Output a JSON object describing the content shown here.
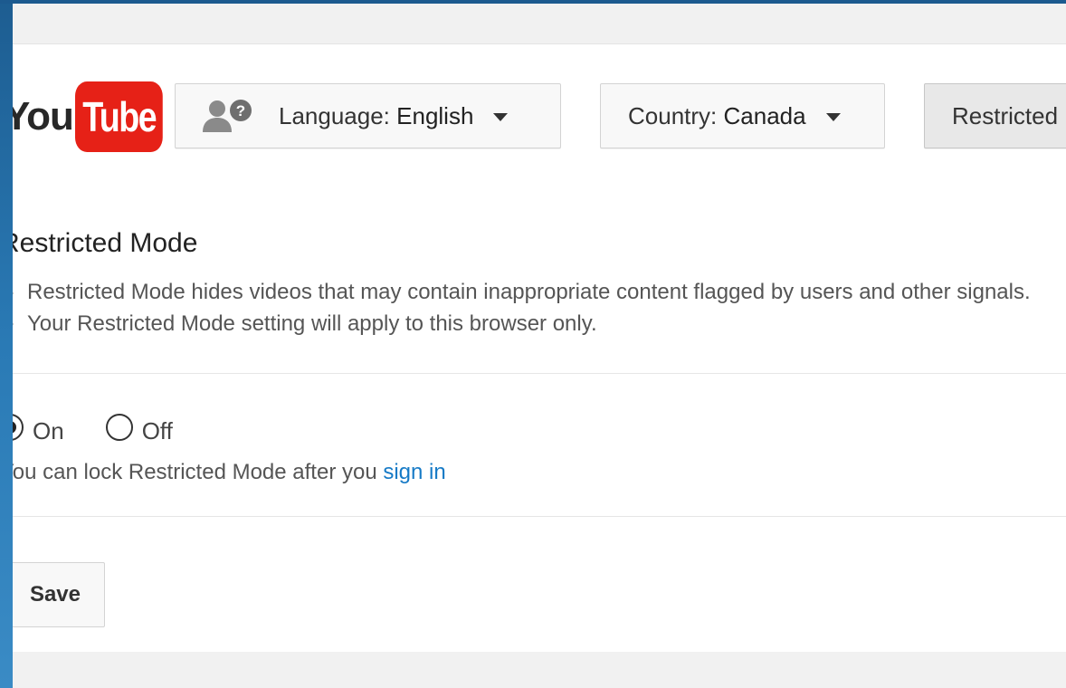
{
  "logo": {
    "you": "You",
    "tube": "Tube"
  },
  "header": {
    "language_label": "Language:",
    "language_value": "English",
    "country_label": "Country:",
    "country_value": "Canada",
    "restricted_label": "Restricted Mode: On"
  },
  "restricted": {
    "title": "Restricted Mode",
    "bullets": [
      "Restricted Mode hides videos that may contain inappropriate content flagged by users and other signals.",
      "Your Restricted Mode setting will apply to this browser only."
    ],
    "options": [
      {
        "label": "On",
        "checked": true
      },
      {
        "label": "Off",
        "checked": false
      }
    ],
    "lock_text": "You can lock Restricted Mode after you",
    "sign_in_link": "sign in",
    "save_label": "Save"
  },
  "colors": {
    "brand_red": "#e62117",
    "link_blue": "#167ac6",
    "desktop_blue": "#2a7ab5"
  }
}
